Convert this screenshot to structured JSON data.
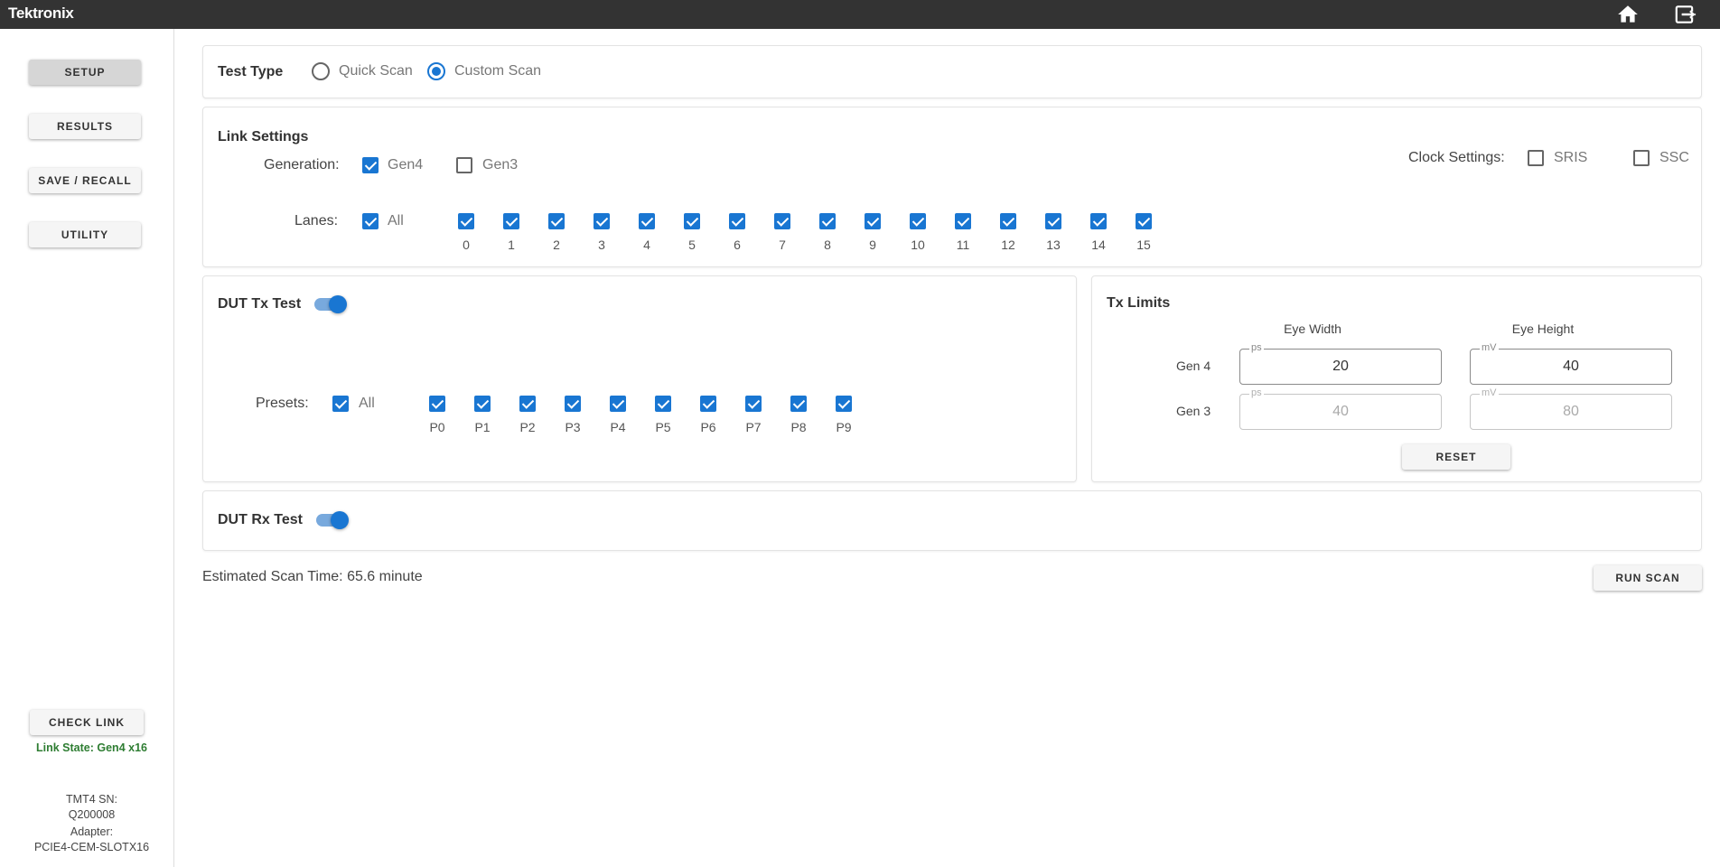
{
  "header": {
    "logo": "Tektronix",
    "home_icon": "home-icon",
    "exit_icon": "exit-icon"
  },
  "sidebar": {
    "buttons": [
      "SETUP",
      "RESULTS",
      "SAVE / RECALL",
      "UTILITY"
    ],
    "active": "SETUP",
    "check_link_label": "CHECK LINK",
    "link_state": "Link State: Gen4 x16",
    "link_state_color": "#2e7d32",
    "sn_label": "TMT4 SN:",
    "sn_value": "Q200008",
    "adapter_label": "Adapter:",
    "adapter_value": "PCIE4-CEM-SLOTX16"
  },
  "test_type": {
    "title": "Test Type",
    "options": [
      "Quick Scan",
      "Custom Scan"
    ],
    "selected": "Custom Scan"
  },
  "link_settings": {
    "title": "Link Settings",
    "generation_label": "Generation:",
    "generations": [
      {
        "label": "Gen4",
        "checked": true
      },
      {
        "label": "Gen3",
        "checked": false
      }
    ],
    "lanes_label": "Lanes:",
    "all_label": "All",
    "all_checked": true,
    "lanes": [
      "0",
      "1",
      "2",
      "3",
      "4",
      "5",
      "6",
      "7",
      "8",
      "9",
      "10",
      "11",
      "12",
      "13",
      "14",
      "15"
    ],
    "clock_label": "Clock Settings:",
    "clock_options": [
      {
        "label": "SRIS",
        "checked": false
      },
      {
        "label": "SSC",
        "checked": false
      }
    ]
  },
  "dut_tx": {
    "title": "DUT Tx Test",
    "enabled": true,
    "presets_label": "Presets:",
    "all_label": "All",
    "all_checked": true,
    "presets": [
      "P0",
      "P1",
      "P2",
      "P3",
      "P4",
      "P5",
      "P6",
      "P7",
      "P8",
      "P9"
    ]
  },
  "tx_limits": {
    "title": "Tx Limits",
    "col_headers": [
      "Eye Width",
      "Eye Height"
    ],
    "rows": [
      {
        "label": "Gen 4",
        "eye_width": "20",
        "eye_height": "40",
        "width_unit": "ps",
        "height_unit": "mV",
        "disabled": false
      },
      {
        "label": "Gen 3",
        "eye_width": "40",
        "eye_height": "80",
        "width_unit": "ps",
        "height_unit": "mV",
        "disabled": true
      }
    ],
    "reset_label": "RESET"
  },
  "dut_rx": {
    "title": "DUT Rx Test",
    "enabled": true
  },
  "footer": {
    "estimated": "Estimated Scan Time: 65.6 minute",
    "run_label": "RUN SCAN"
  },
  "colors": {
    "accent": "#1976d2",
    "topbar": "#333333",
    "link_state": "#2e7d32"
  }
}
